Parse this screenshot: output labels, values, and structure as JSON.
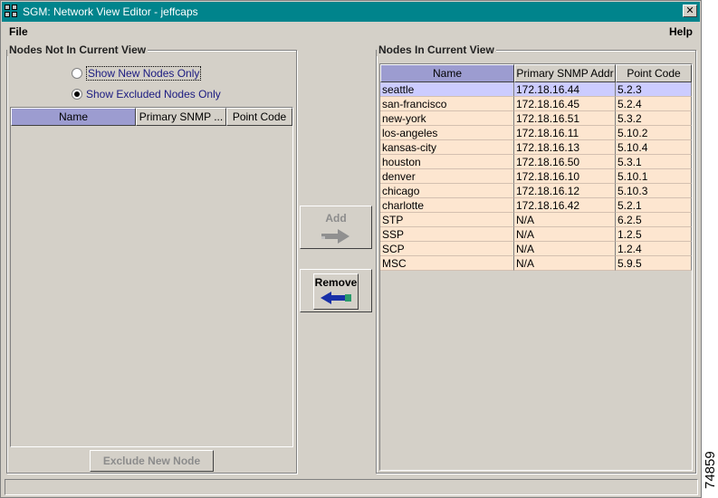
{
  "window": {
    "title": "SGM: Network View Editor - jeffcaps"
  },
  "menu": {
    "file": "File",
    "help": "Help"
  },
  "left_panel": {
    "title": "Nodes Not In Current View",
    "radio_new": "Show New Nodes Only",
    "radio_excluded": "Show Excluded Nodes Only",
    "selected_radio": "excluded",
    "columns": [
      "Name",
      "Primary SNMP ...",
      "Point Code"
    ],
    "exclude_button": "Exclude New Node"
  },
  "middle": {
    "add_label": "Add",
    "remove_label": "Remove"
  },
  "right_panel": {
    "title": "Nodes In Current View",
    "columns": [
      "Name",
      "Primary SNMP Addr",
      "Point Code"
    ],
    "rows": [
      [
        "seattle",
        "172.18.16.44",
        "5.2.3"
      ],
      [
        "san-francisco",
        "172.18.16.45",
        "5.2.4"
      ],
      [
        "new-york",
        "172.18.16.51",
        "5.3.2"
      ],
      [
        "los-angeles",
        "172.18.16.11",
        "5.10.2"
      ],
      [
        "kansas-city",
        "172.18.16.13",
        "5.10.4"
      ],
      [
        "houston",
        "172.18.16.50",
        "5.3.1"
      ],
      [
        "denver",
        "172.18.16.10",
        "5.10.1"
      ],
      [
        "chicago",
        "172.18.16.12",
        "5.10.3"
      ],
      [
        "charlotte",
        "172.18.16.42",
        "5.2.1"
      ],
      [
        "STP",
        "N/A",
        "6.2.5"
      ],
      [
        "SSP",
        "N/A",
        "1.2.5"
      ],
      [
        "SCP",
        "N/A",
        "1.2.4"
      ],
      [
        "MSC",
        "N/A",
        "5.9.5"
      ]
    ],
    "selected_row": 0
  },
  "figure_id": "74859"
}
